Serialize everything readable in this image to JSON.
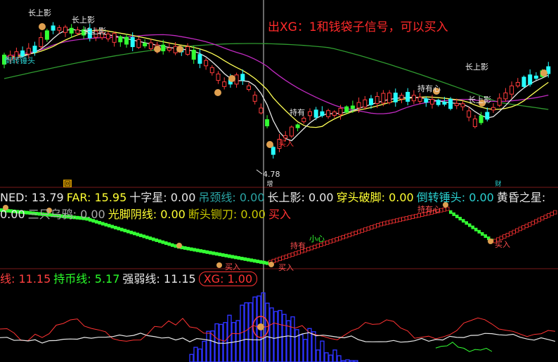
{
  "annotation": "出XG：1和钱袋子信号，可以买入",
  "main_chart": {
    "labels_long_shadow": [
      "长上影",
      "长上影",
      "长上影",
      "长上影",
      "长上影"
    ],
    "label_left": "倒转锤头",
    "price_low": "4.78",
    "label_hold": "持有",
    "label_hold_heart": "持有心",
    "label_buy": "买入",
    "x_axis_tags": [
      "回",
      "增",
      "财"
    ]
  },
  "indicator1": {
    "items": [
      {
        "name": "NED:",
        "value": "13.79",
        "color": "#e8e8e8"
      },
      {
        "name": "FAR:",
        "value": "15.95",
        "color": "#ffff33"
      },
      {
        "name": "十字星:",
        "value": "0.00",
        "color": "#e8e8e8"
      },
      {
        "name": "吊颈线:",
        "value": "0.00",
        "color": "#2aa4a4"
      },
      {
        "name": "长上影:",
        "value": "0.00",
        "color": "#e8e8e8"
      },
      {
        "name": "穿头破脚:",
        "value": "0.00",
        "color": "#ffff33"
      },
      {
        "name": "倒转锤头:",
        "value": "0.00",
        "color": "#2ad0d0"
      },
      {
        "name": "黄昏之星:",
        "value": "0.00",
        "color": "#e8e8e8"
      },
      {
        "name": "三只乌鸦:",
        "value": "0.00",
        "color": "#aaaaaa"
      },
      {
        "name": "光脚阴线:",
        "value": "0.00",
        "color": "#ffff33"
      },
      {
        "name": "断头铡刀:",
        "value": "0.00",
        "color": "#c8c800"
      },
      {
        "name": "买入",
        "value": "",
        "color": "#ff3333"
      }
    ],
    "labels": {
      "hold": "持有",
      "careful": "小心",
      "hold_heart": "持有心",
      "buy": "买入"
    }
  },
  "indicator2": {
    "items": [
      {
        "name": "线:",
        "value": "11.15",
        "color": "#ff4040"
      },
      {
        "name": "持币线:",
        "value": "5.17",
        "color": "#2aff2a"
      },
      {
        "name": "强弱线:",
        "value": "11.15",
        "color": "#e8e8e8"
      },
      {
        "name": "XG:",
        "value": "1.00",
        "color": "#ff3333"
      }
    ]
  },
  "colors": {
    "up": "#ff3b3b",
    "down": "#27ffff",
    "green": "#33ff33",
    "ma_yellow": "#ffff55",
    "ma_purple": "#c02ac0",
    "ma_green": "#2f9a2f",
    "annotation": "#ff2a2a"
  }
}
